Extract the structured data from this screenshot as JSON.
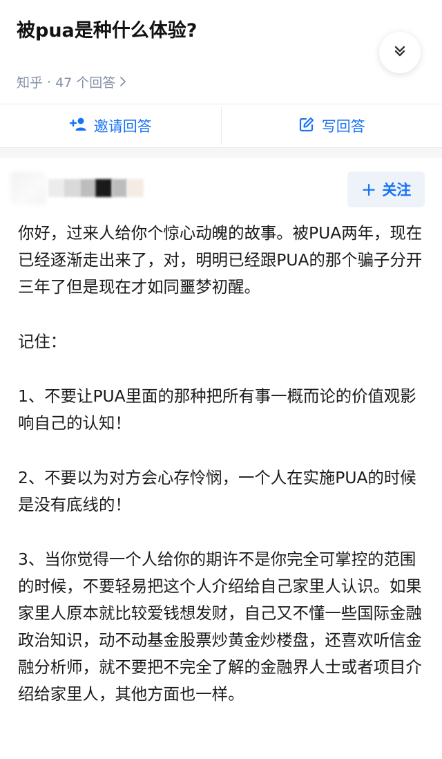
{
  "question": {
    "title": "被pua是种什么体验?",
    "source": "知乎",
    "separator": "·",
    "answer_count": "47 个回答"
  },
  "actions": {
    "invite_label": "邀请回答",
    "write_label": "写回答"
  },
  "author": {
    "follow_label": "关注"
  },
  "answer": {
    "paragraphs": [
      "你好，过来人给你个惊心动魄的故事。被PUA两年，现在已经逐渐走出来了，对，明明已经跟PUA的那个骗子分开三年了但是现在才如同噩梦初醒。",
      "记住：",
      "1、不要让PUA里面的那种把所有事一概而论的价值观影响自己的认知！",
      "2、不要以为对方会心存怜悯，一个人在实施PUA的时候是没有底线的！",
      "3、当你觉得一个人给你的期许不是你完全可掌控的范围的时候，不要轻易把这个人介绍给自己家里人认识。如果家里人原本就比较爱钱想发财，自己又不懂一些国际金融政治知识，动不动基金股票炒黄金炒楼盘，还喜欢听信金融分析师，就不要把不完全了解的金融界人士或者项目介绍给家里人，其他方面也一样。"
    ]
  },
  "colors": {
    "accent": "#1772f6",
    "meta": "#8590a6",
    "follow_bg": "#eef3fa"
  },
  "icons": [
    "chevron-double-down-icon",
    "chevron-right-icon",
    "add-user-icon",
    "edit-icon",
    "plus-icon"
  ]
}
